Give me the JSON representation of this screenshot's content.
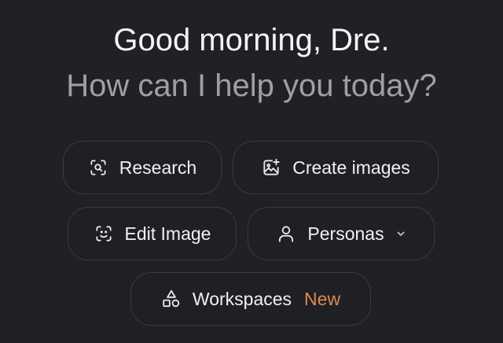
{
  "greeting": {
    "title": "Good morning, Dre.",
    "subtitle": "How can I help you today?"
  },
  "actions": [
    {
      "id": "research",
      "label": "Research",
      "icon": "search-focus-icon"
    },
    {
      "id": "create_images",
      "label": "Create images",
      "icon": "image-sparkle-icon"
    },
    {
      "id": "edit_image",
      "label": "Edit Image",
      "icon": "face-scan-icon"
    },
    {
      "id": "personas",
      "label": "Personas",
      "icon": "person-icon",
      "dropdown": true
    },
    {
      "id": "workspaces",
      "label": "Workspaces",
      "icon": "shapes-icon",
      "badge": "New"
    }
  ],
  "colors": {
    "background": "#202124",
    "chip_border": "#3a3b3f",
    "subtitle": "#9ea0a6",
    "badge": "#d98a5a"
  }
}
